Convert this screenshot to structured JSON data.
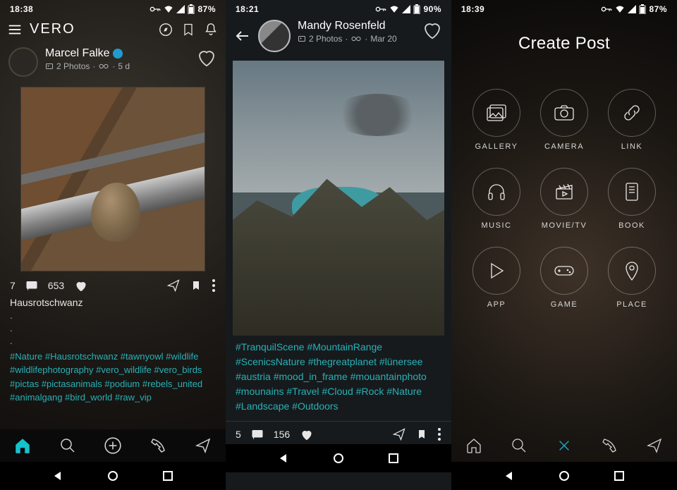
{
  "screens": [
    {
      "status": {
        "time": "18:38",
        "battery": "87%"
      },
      "brand": "VERO",
      "post": {
        "author": "Marcel Falke",
        "verified": true,
        "meta_photos": "2 Photos",
        "meta_age": "5 d",
        "avatar_label": "",
        "comments": "7",
        "likes": "653",
        "caption": "Hausrotschwanz",
        "dots": ". . .",
        "hashtags": "#Nature #Hausrotschwanz #tawnyowl #wildlife #wildlifephotography #vero_wildlife #vero_birds #pictas #pictasanimals #podium #rebels_united #animalgang #bird_world #raw_vip"
      }
    },
    {
      "status": {
        "time": "18:21",
        "battery": "90%"
      },
      "post": {
        "author": "Mandy Rosenfeld",
        "meta_photos": "2 Photos",
        "meta_date": "Mar 20",
        "hashtags": "#TranquilScene #MountainRange #ScenicsNature #thegreatplanet #lünersee #austria #mood_in_frame #mouantainphoto #mounains #Travel #Cloud #Rock #Nature #Landscape #Outdoors",
        "comments": "5",
        "likes": "156"
      }
    },
    {
      "status": {
        "time": "18:39",
        "battery": "87%"
      },
      "title": "Create Post",
      "options": [
        {
          "label": "GALLERY",
          "icon": "gallery"
        },
        {
          "label": "CAMERA",
          "icon": "camera"
        },
        {
          "label": "LINK",
          "icon": "link"
        },
        {
          "label": "MUSIC",
          "icon": "music"
        },
        {
          "label": "MOVIE/TV",
          "icon": "movie"
        },
        {
          "label": "BOOK",
          "icon": "book"
        },
        {
          "label": "APP",
          "icon": "app"
        },
        {
          "label": "GAME",
          "icon": "game"
        },
        {
          "label": "PLACE",
          "icon": "place"
        }
      ]
    }
  ]
}
